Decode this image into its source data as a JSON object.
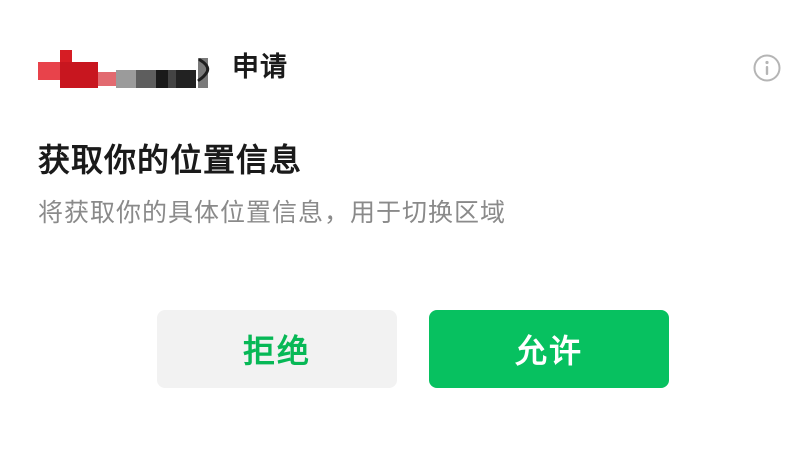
{
  "header": {
    "request_label": "申请",
    "info_icon": "info-circle-icon"
  },
  "dialog": {
    "title": "获取你的位置信息",
    "description": "将获取你的具体位置信息，用于切换区域"
  },
  "actions": {
    "deny_label": "拒绝",
    "allow_label": "允许"
  },
  "colors": {
    "accent_green": "#07c160",
    "deny_text_green": "#07b856",
    "deny_background": "#f2f2f2",
    "description_gray": "#8a8a8a",
    "info_icon_gray": "#b5b5b5"
  }
}
